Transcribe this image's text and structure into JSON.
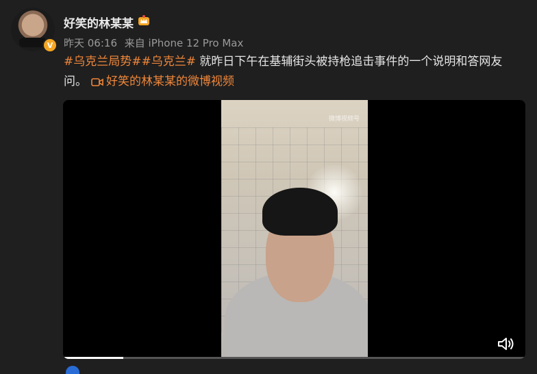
{
  "post": {
    "username": "好笑的林某某",
    "verified_badge": "V",
    "meta": {
      "time": "昨天 06:16",
      "source": "来自 iPhone 12 Pro Max"
    },
    "content": {
      "hashtag1": "#乌克兰局势#",
      "hashtag2": "#乌克兰#",
      "text": " 就昨日下午在基辅街头被持枪追击事件的一个说明和答网友问。",
      "video_link_label": "好笑的林某某的微博视频"
    },
    "video": {
      "watermark": "微博视频号",
      "progress": 0.13,
      "muted": true
    }
  },
  "icons": {
    "crown": "crown-icon",
    "video_link": "video-camera-icon",
    "mute": "volume-icon"
  },
  "colors": {
    "hashtag": "#f0873a",
    "badge": "#f5a623"
  }
}
